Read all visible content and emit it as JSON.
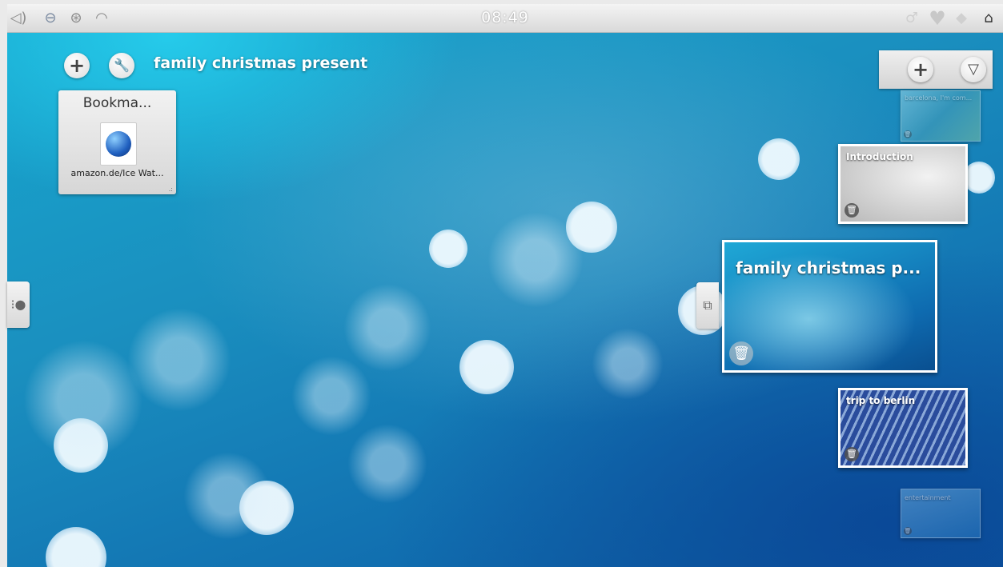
{
  "statusbar": {
    "clock": "08:49",
    "left_icons": [
      "volume-icon",
      "network-icon",
      "usb-icon",
      "wifi-icon"
    ],
    "right_icons": [
      "notification-icon",
      "heart-icon",
      "diamond-icon",
      "home-icon"
    ]
  },
  "activity": {
    "title": "family christmas present",
    "add_icon": "+",
    "configure_icon": "🔧"
  },
  "bookmark_widget": {
    "title": "Bookma...",
    "link_label": "amazon.de/Ice Wat...",
    "resize_glyph": ".:"
  },
  "right_panel": {
    "add_icon": "+",
    "filter_icon": "▽"
  },
  "activities": [
    {
      "label": "barcelona, I'm com..."
    },
    {
      "label": "Introduction"
    },
    {
      "label": "family christmas p..."
    },
    {
      "label": "trip to berlin"
    },
    {
      "label": "entertainment"
    }
  ],
  "icons": {
    "trash": "🗑",
    "left_tab": "⁝●",
    "right_tab": "⧉"
  },
  "colors": {
    "background_top": "#17a8cf",
    "background_bottom": "#0c5aa0",
    "panel": "#e0e0e0"
  }
}
